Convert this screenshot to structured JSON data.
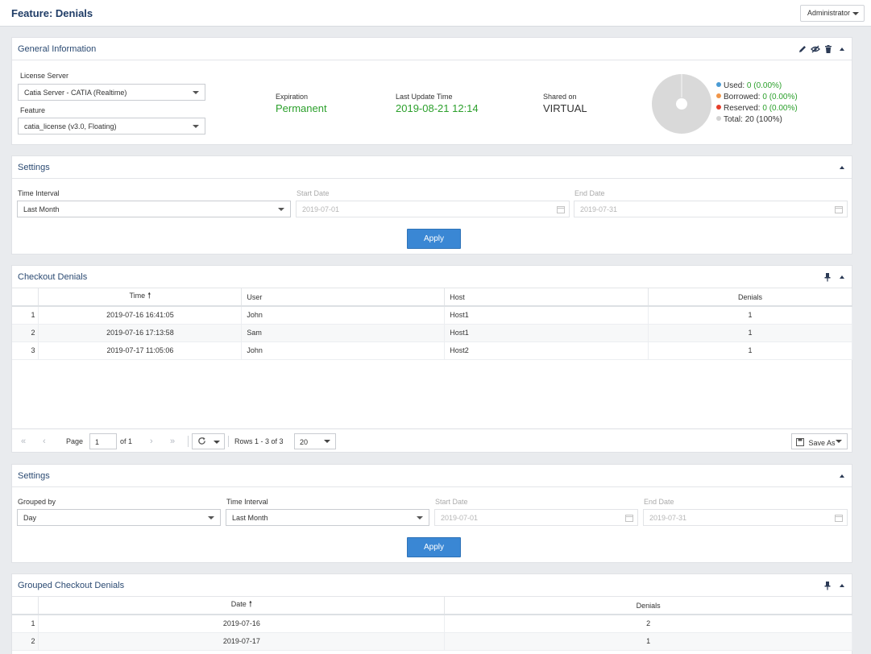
{
  "header": {
    "title": "Feature: Denials",
    "user_menu": "Administrator"
  },
  "general_info": {
    "title": "General Information",
    "license_server_label": "License Server",
    "license_server_value": "Catia Server - CATIA (Realtime)",
    "feature_label": "Feature",
    "feature_value": "catia_license (v3.0, Floating)",
    "expiration_label": "Expiration",
    "expiration_value": "Permanent",
    "last_update_label": "Last Update Time",
    "last_update_value": "2019-08-21 12:14",
    "shared_on_label": "Shared on",
    "shared_on_value": "VIRTUAL",
    "legend": [
      {
        "label": "Used:",
        "value": "0 (0.00%)",
        "color": "#4a9bd4"
      },
      {
        "label": "Borrowed:",
        "value": "0 (0.00%)",
        "color": "#f0964a"
      },
      {
        "label": "Reserved:",
        "value": "0 (0.00%)",
        "color": "#e53e2a"
      },
      {
        "label": "Total:",
        "value": "20 (100%)",
        "color": "#d3d3d3"
      }
    ]
  },
  "settings1": {
    "title": "Settings",
    "time_interval_label": "Time Interval",
    "time_interval_value": "Last Month",
    "start_date_label": "Start Date",
    "start_date_value": "2019-07-01",
    "end_date_label": "End Date",
    "end_date_value": "2019-07-31",
    "apply_label": "Apply"
  },
  "checkout_denials": {
    "title": "Checkout Denials",
    "columns": [
      "Time",
      "User",
      "Host",
      "Denials"
    ],
    "rows": [
      {
        "n": "1",
        "time": "2019-07-16 16:41:05",
        "user": "John",
        "host": "Host1",
        "denials": "1"
      },
      {
        "n": "2",
        "time": "2019-07-16 17:13:58",
        "user": "Sam",
        "host": "Host1",
        "denials": "1"
      },
      {
        "n": "3",
        "time": "2019-07-17 11:05:06",
        "user": "John",
        "host": "Host2",
        "denials": "1"
      }
    ],
    "pager": {
      "page_label": "Page",
      "page_value": "1",
      "of_label": "of 1",
      "rows_label": "Rows 1 - 3 of 3",
      "page_size": "20",
      "save_as": "Save As"
    }
  },
  "settings2": {
    "title": "Settings",
    "grouped_by_label": "Grouped by",
    "grouped_by_value": "Day",
    "time_interval_label": "Time Interval",
    "time_interval_value": "Last Month",
    "start_date_label": "Start Date",
    "start_date_value": "2019-07-01",
    "end_date_label": "End Date",
    "end_date_value": "2019-07-31",
    "apply_label": "Apply"
  },
  "grouped_denials": {
    "title": "Grouped Checkout Denials",
    "columns": [
      "Date",
      "Denials"
    ],
    "rows": [
      {
        "n": "1",
        "date": "2019-07-16",
        "denials": "2"
      },
      {
        "n": "2",
        "date": "2019-07-17",
        "denials": "1"
      }
    ]
  },
  "colors": {
    "accent": "#3a87d4",
    "title": "#1f3c66",
    "green": "#2ca02c"
  }
}
